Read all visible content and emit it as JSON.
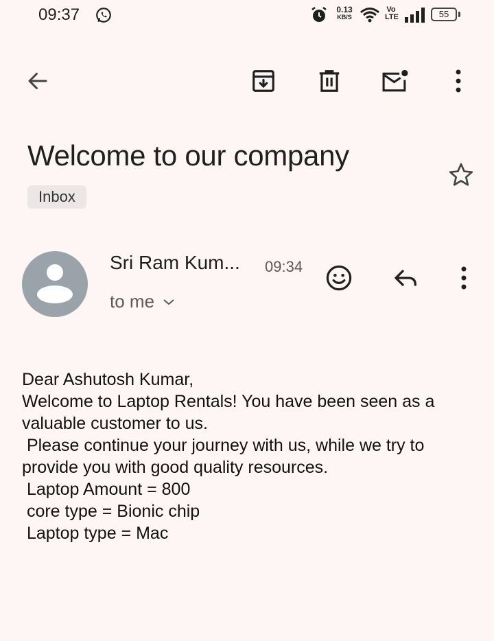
{
  "status_bar": {
    "time": "09:37",
    "net_speed_value": "0.13",
    "net_speed_unit": "KB/S",
    "volte": "Vo LTE",
    "battery": "55",
    "icons": [
      "whatsapp-icon",
      "alarm-icon",
      "wifi-icon",
      "signal-icon",
      "battery-icon"
    ]
  },
  "toolbar": {
    "icons": [
      "back-arrow-icon",
      "archive-icon",
      "delete-icon",
      "mark-unread-icon",
      "more-vert-icon"
    ]
  },
  "email": {
    "subject": "Welcome to our company",
    "label_chip": "Inbox",
    "sender": "Sri Ram Kum...",
    "time": "09:34",
    "recipient": "to me",
    "body": "Dear Ashutosh Kumar,\nWelcome to Laptop Rentals! You have been seen as a valuable customer to us.\n Please continue your journey with us, while we try to provide you with good quality resources.\n Laptop Amount = 800\n core type = Bionic chip\n Laptop type = Mac"
  },
  "colors": {
    "background": "#fdf6f5",
    "avatar": "#9aa3aa",
    "chip": "#ece7e6"
  }
}
